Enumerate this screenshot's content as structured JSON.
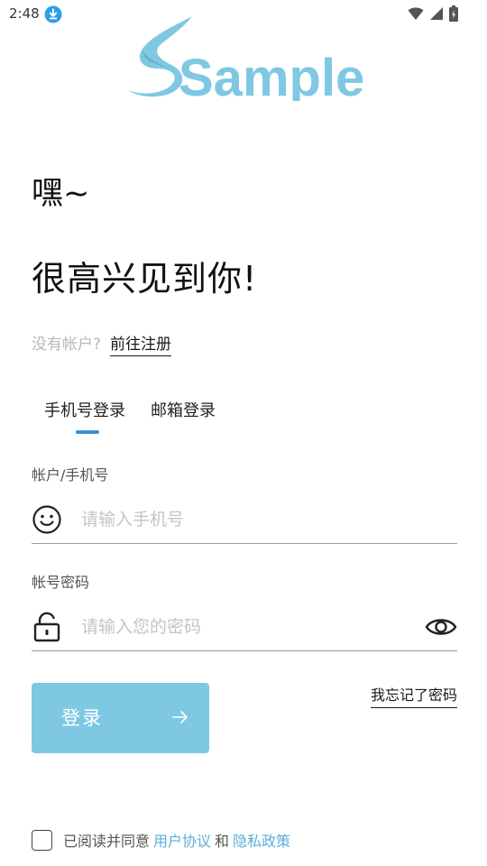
{
  "status_bar": {
    "time": "2:48"
  },
  "logo": {
    "text": "Sample",
    "color": "#7ec8e3"
  },
  "greeting": "嘿~",
  "welcome": "很高兴见到你!",
  "register": {
    "prompt": "没有帐户?",
    "link": "前往注册"
  },
  "tabs": [
    {
      "label": "手机号登录",
      "active": true
    },
    {
      "label": "邮箱登录",
      "active": false
    }
  ],
  "account_field": {
    "label": "帐户/手机号",
    "placeholder": "请输入手机号",
    "value": ""
  },
  "password_field": {
    "label": "帐号密码",
    "placeholder": "请输入您的密码",
    "value": ""
  },
  "forgot_password": "我忘记了密码",
  "login_button": {
    "label": "登录"
  },
  "agreement": {
    "prefix": "已阅读并同意",
    "user_agreement": "用户协议",
    "and": "和",
    "privacy_policy": "隐私政策",
    "checked": false
  },
  "colors": {
    "accent": "#7ec8e3",
    "tab_indicator": "#3a8fd6",
    "link": "#5aaed8"
  }
}
